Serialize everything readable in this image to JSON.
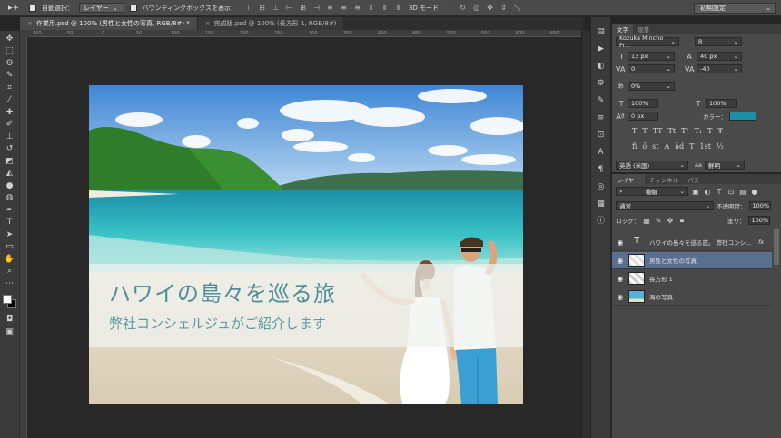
{
  "options_bar": {
    "move_tool_label": "▸+",
    "auto_select_label": "自動選択：",
    "auto_select_value": "レイヤー",
    "bounding_box_label": "バウンディングボックスを表示",
    "mode_3d_label": "3D モード：",
    "workspace_value": "初期設定"
  },
  "document_tabs": [
    {
      "label": "作業用.psd @ 100% (男性と女性の写真, RGB/8#) *",
      "active": true
    },
    {
      "label": "完成版.psd @ 100% (長方形 1, RGB/8#)",
      "active": false
    }
  ],
  "ruler": {
    "labels": [
      "100",
      "50",
      "0",
      "50",
      "100",
      "150",
      "200",
      "250",
      "300",
      "350",
      "400",
      "450",
      "500",
      "550",
      "600",
      "650"
    ]
  },
  "canvas": {
    "title": "ハワイの島々を巡る旅",
    "subtitle": "弊社コンシェルジュがご紹介します",
    "colors": {
      "sky_top": "#4a8fd8",
      "sky_bottom": "#b9d7f0",
      "sea_deep": "#1f9fb3",
      "sea_light": "#5fd1cf",
      "sand": "#e8dfcf",
      "hill": "#2f7d2a",
      "title_color": "#4d8c98"
    }
  },
  "character_panel": {
    "tabs": [
      "文字",
      "段落"
    ],
    "font_family": "Kozuka Mincho Pr...",
    "font_style": "R",
    "font_size": "13 px",
    "leading": "40 px",
    "kerning": "0",
    "tracking": "-40",
    "tsume": "0%",
    "vertical_scale": "100%",
    "horizontal_scale": "100%",
    "baseline_shift": "0 px",
    "color_label": "カラー：",
    "color_value": "#1c8fa5",
    "style_buttons": [
      "T",
      "T",
      "TT",
      "Tt",
      "T¹",
      "T₁",
      "T",
      "Ŧ"
    ],
    "opentype_buttons": [
      "fi",
      "ő",
      "st",
      "A",
      "ād",
      "T",
      "1st",
      "½"
    ],
    "language": "英語 (米国)",
    "aa_label": "aa",
    "aa_value": "鮮明"
  },
  "layers_panel": {
    "tabs": [
      "レイヤー",
      "チャンネル",
      "パス"
    ],
    "filter_kind": "種類",
    "blend_mode": "通常",
    "opacity_label": "不透明度：",
    "opacity_value": "100%",
    "lock_label": "ロック：",
    "fill_label": "塗り：",
    "fill_value": "100%",
    "layers": [
      {
        "name": "ハワイの島々を巡る旅。 弊社コンシ...",
        "kind": "text",
        "selected": false,
        "has_fx": true
      },
      {
        "name": "男性と女性の写真",
        "kind": "image",
        "selected": true,
        "has_fx": false
      },
      {
        "name": "長方形 1",
        "kind": "shape",
        "selected": false,
        "has_fx": false
      },
      {
        "name": "海の写真",
        "kind": "image",
        "selected": false,
        "has_fx": false
      }
    ],
    "fx_label": "fx"
  },
  "tools": [
    "move",
    "marquee",
    "lasso",
    "quick-select",
    "crop",
    "eyedropper",
    "healing",
    "brush",
    "stamp",
    "history-brush",
    "eraser",
    "gradient",
    "blur",
    "dodge",
    "pen",
    "type",
    "path-select",
    "shape",
    "hand",
    "zoom",
    "more"
  ]
}
